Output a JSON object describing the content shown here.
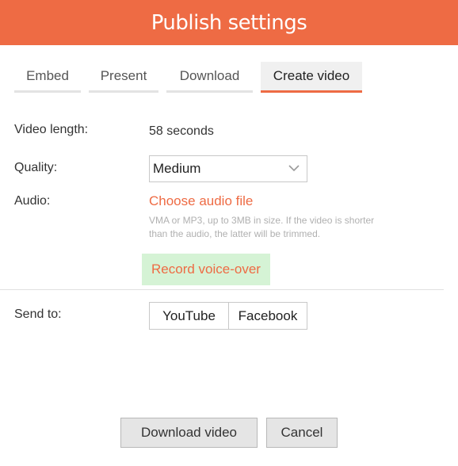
{
  "header": {
    "title": "Publish settings",
    "accent_color": "#ee6b44"
  },
  "tabs": [
    {
      "label": "Embed",
      "active": false
    },
    {
      "label": "Present",
      "active": false
    },
    {
      "label": "Download",
      "active": false
    },
    {
      "label": "Create video",
      "active": true
    }
  ],
  "video_length": {
    "label": "Video length:",
    "value": "58 seconds"
  },
  "quality": {
    "label": "Quality:",
    "selected": "Medium",
    "icon": "chevron-down-icon"
  },
  "audio": {
    "label": "Audio:",
    "choose_file": "Choose audio file",
    "hint": "VMA or MP3, up to 3MB in size. If the video is shorter than the audio, the latter will be trimmed.",
    "record_button": "Record voice-over",
    "record_button_bg": "#d5f3d5"
  },
  "send_to": {
    "label": "Send to:",
    "options": [
      "YouTube",
      "Facebook"
    ]
  },
  "footer": {
    "download_label": "Download video",
    "cancel_label": "Cancel"
  }
}
